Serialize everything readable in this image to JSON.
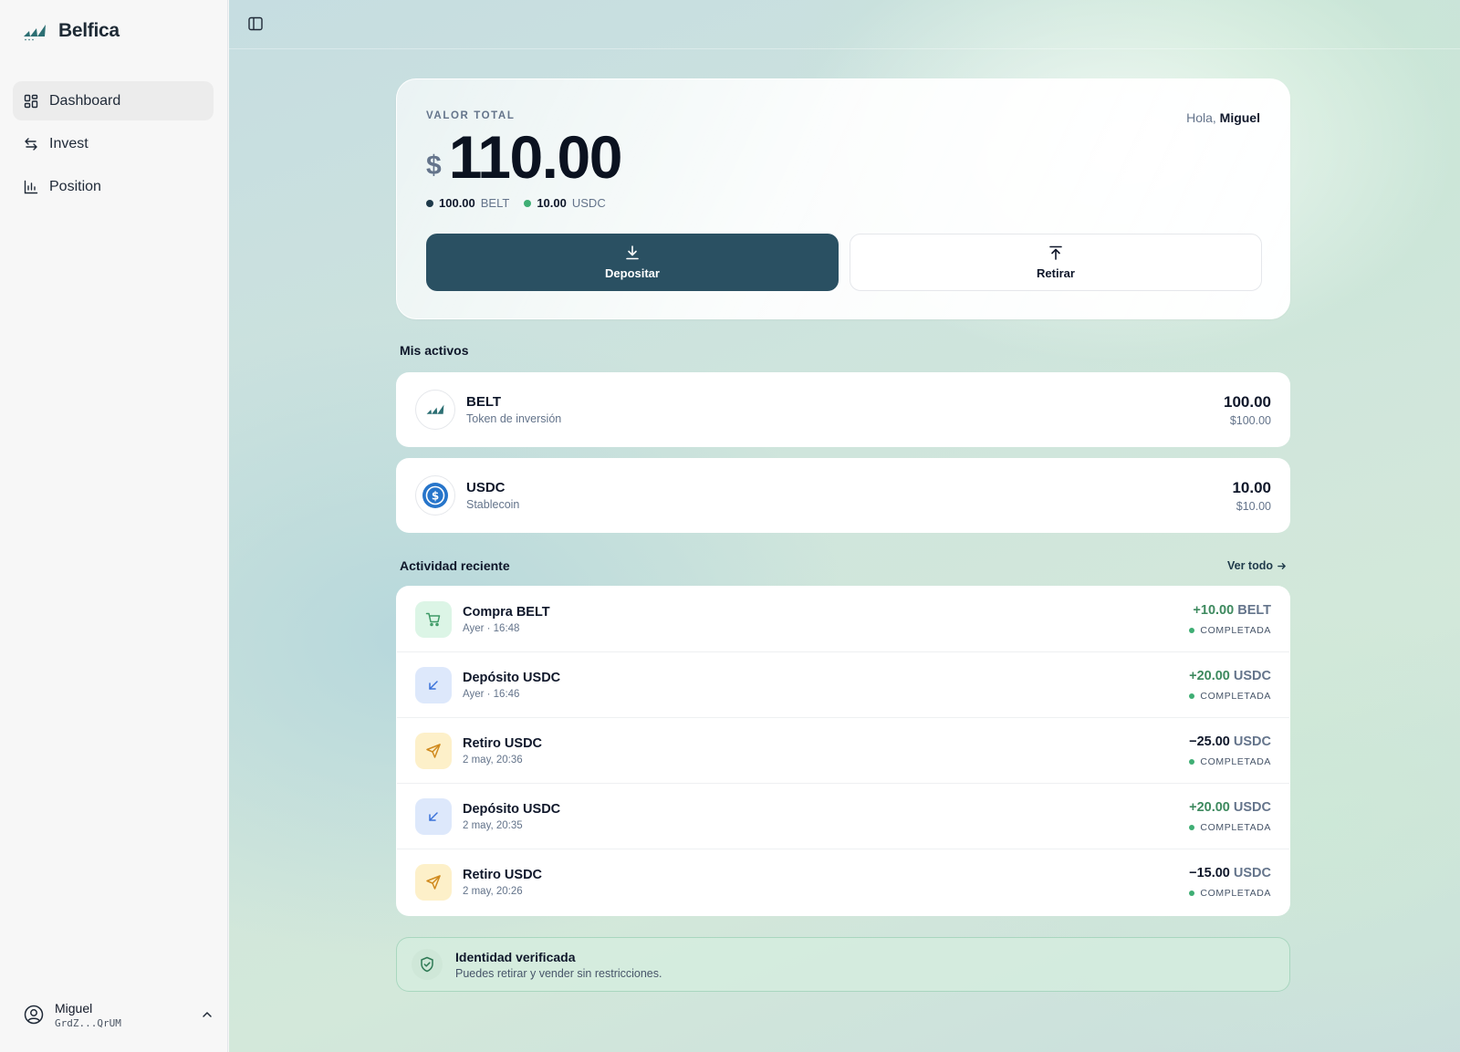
{
  "app": {
    "name": "Belfica"
  },
  "sidebar": {
    "items": [
      {
        "label": "Dashboard",
        "icon": "grid-icon",
        "active": true
      },
      {
        "label": "Invest",
        "icon": "arrows-exchange-icon",
        "active": false
      },
      {
        "label": "Position",
        "icon": "chart-bars-icon",
        "active": false
      }
    ],
    "user": {
      "name": "Miguel",
      "address": "GrdZ...QrUM"
    }
  },
  "hero": {
    "label": "VALOR TOTAL",
    "greeting_prefix": "Hola,",
    "greeting_name": "Miguel",
    "currency_symbol": "$",
    "total": "110.00",
    "holdings": [
      {
        "value": "100.00",
        "token": "BELT",
        "color": "#1e3a4a"
      },
      {
        "value": "10.00",
        "token": "USDC",
        "color": "#3fae74"
      }
    ],
    "deposit_label": "Depositar",
    "withdraw_label": "Retirar"
  },
  "assets": {
    "title": "Mis activos",
    "items": [
      {
        "name": "BELT",
        "subtitle": "Token de inversión",
        "qty": "100.00",
        "usd": "$100.00",
        "icon": "belt-logo-icon"
      },
      {
        "name": "USDC",
        "subtitle": "Stablecoin",
        "qty": "10.00",
        "usd": "$10.00",
        "icon": "usdc-logo-icon"
      }
    ]
  },
  "activity": {
    "title": "Actividad reciente",
    "see_all": "Ver todo",
    "rows": [
      {
        "title": "Compra BELT",
        "time": "Ayer · 16:48",
        "amount": "+10.00",
        "token": "BELT",
        "status": "COMPLETADA",
        "kind": "buy"
      },
      {
        "title": "Depósito USDC",
        "time": "Ayer · 16:46",
        "amount": "+20.00",
        "token": "USDC",
        "status": "COMPLETADA",
        "kind": "deposit"
      },
      {
        "title": "Retiro USDC",
        "time": "2 may, 20:36",
        "amount": "−25.00",
        "token": "USDC",
        "status": "COMPLETADA",
        "kind": "withdraw"
      },
      {
        "title": "Depósito USDC",
        "time": "2 may, 20:35",
        "amount": "+20.00",
        "token": "USDC",
        "status": "COMPLETADA",
        "kind": "deposit"
      },
      {
        "title": "Retiro USDC",
        "time": "2 may, 20:26",
        "amount": "−15.00",
        "token": "USDC",
        "status": "COMPLETADA",
        "kind": "withdraw"
      }
    ]
  },
  "verified": {
    "title": "Identidad verificada",
    "subtitle": "Puedes retirar y vender sin restricciones."
  },
  "colors": {
    "primary": "#2a5062",
    "positive": "#3e8a5f",
    "status_dot": "#3fae74"
  }
}
